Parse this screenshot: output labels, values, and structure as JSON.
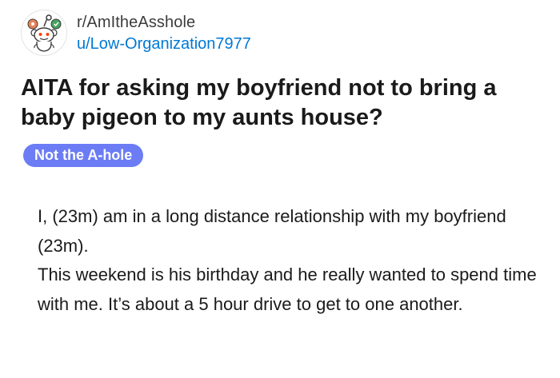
{
  "post": {
    "subreddit": "r/AmItheAsshole",
    "username": "u/Low-Organization7977",
    "title": "AITA for asking my boyfriend not to bring a baby pigeon to my aunts house?",
    "flair": "Not the A-hole",
    "body": [
      "I, (23m) am in a long distance relationship with my boyfriend (23m).",
      "This weekend is his birthday and he really wanted to spend time with me. It’s about a 5 hour drive to get to one another."
    ]
  },
  "colors": {
    "flair_bg": "#6b7cf5",
    "username": "#0079d3",
    "text": "#1a1a1b"
  },
  "icons": {
    "avatar": "snoo-avatar-icon"
  }
}
